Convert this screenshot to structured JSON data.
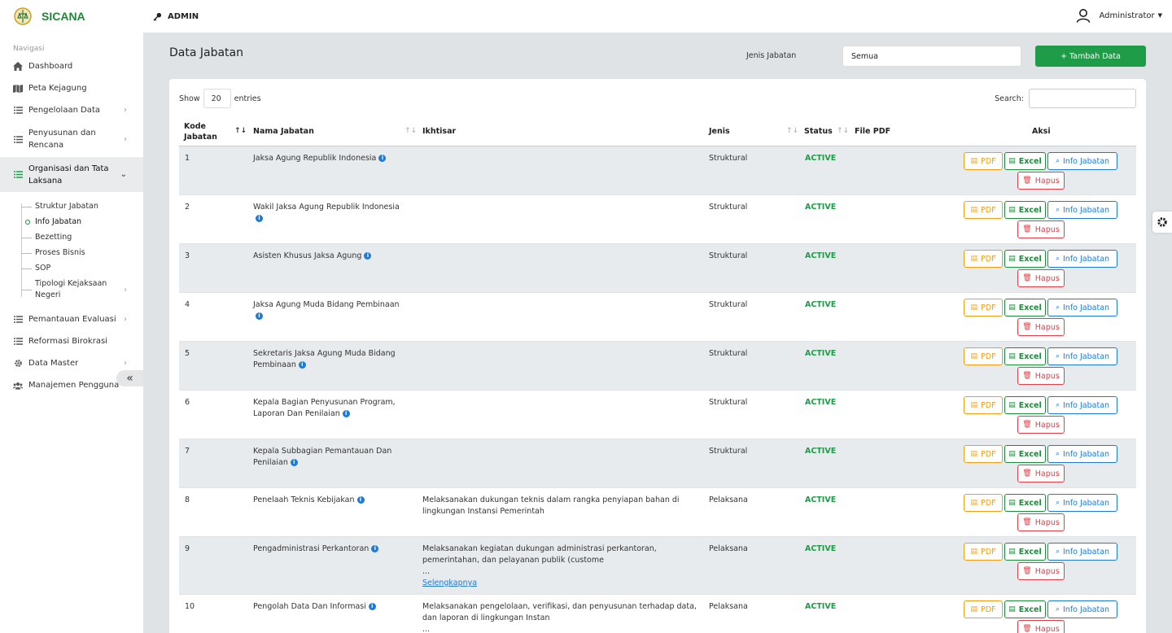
{
  "app": {
    "name": "SICANA",
    "role": "ADMIN",
    "user": "Administrator"
  },
  "sidebar": {
    "heading": "Navigasi",
    "items": [
      {
        "label": "Dashboard",
        "icon": "home-icon"
      },
      {
        "label": "Peta Kejagung",
        "icon": "map-icon"
      },
      {
        "label": "Pengelolaan Data",
        "icon": "list-icon"
      },
      {
        "label": "Penyusunan dan Rencana",
        "icon": "list-icon"
      },
      {
        "label": "Organisasi dan Tata Laksana",
        "icon": "list-icon"
      },
      {
        "label": "Pemantauan Evaluasi",
        "icon": "list-icon"
      },
      {
        "label": "Reformasi Birokrasi",
        "icon": "list-icon"
      },
      {
        "label": "Data Master",
        "icon": "gear-icon"
      },
      {
        "label": "Manajemen Pengguna",
        "icon": "users-icon"
      }
    ],
    "subitems": [
      "Struktur Jabatan",
      "Info Jabatan",
      "Bezetting",
      "Proses Bisnis",
      "SOP",
      "Tipologi Kejaksaan Negeri"
    ],
    "active_sub": "Info Jabatan",
    "collapse_glyph": "«"
  },
  "page": {
    "title": "Data Jabatan",
    "filter_label": "Jenis Jabatan",
    "filter_value": "Semua",
    "add_button": "+ Tambah Data"
  },
  "table": {
    "show_label": "Show",
    "entries_value": "20",
    "entries_label": "entries",
    "search_label": "Search:",
    "columns": [
      "Kode Jabatan",
      "Nama Jabatan",
      "Ikhtisar",
      "Jenis",
      "Status",
      "File PDF",
      "Aksi"
    ],
    "actions": {
      "pdf": "PDF",
      "excel": "Excel",
      "info": "Info Jabatan",
      "delete": "Hapus"
    },
    "rows": [
      {
        "kode": "1",
        "nama": "Jaksa Agung Republik Indonesia",
        "ikhtisar": "",
        "jenis": "Struktural",
        "status": "ACTIVE"
      },
      {
        "kode": "2",
        "nama": "Wakil Jaksa Agung Republik Indonesia",
        "ikhtisar": "",
        "jenis": "Struktural",
        "status": "ACTIVE"
      },
      {
        "kode": "3",
        "nama": "Asisten Khusus Jaksa Agung",
        "ikhtisar": "",
        "jenis": "Struktural",
        "status": "ACTIVE"
      },
      {
        "kode": "4",
        "nama": "Jaksa Agung Muda Bidang Pembinaan",
        "ikhtisar": "",
        "jenis": "Struktural",
        "status": "ACTIVE"
      },
      {
        "kode": "5",
        "nama": "Sekretaris Jaksa Agung Muda Bidang Pembinaan",
        "ikhtisar": "",
        "jenis": "Struktural",
        "status": "ACTIVE"
      },
      {
        "kode": "6",
        "nama": "Kepala Bagian Penyusunan Program, Laporan Dan Penilaian",
        "ikhtisar": "",
        "jenis": "Struktural",
        "status": "ACTIVE"
      },
      {
        "kode": "7",
        "nama": "Kepala Subbagian Pemantauan Dan Penilaian",
        "ikhtisar": "",
        "jenis": "Struktural",
        "status": "ACTIVE"
      },
      {
        "kode": "8",
        "nama": "Penelaah Teknis Kebijakan",
        "ikhtisar": "Melaksanakan dukungan teknis dalam rangka penyiapan bahan di lingkungan Instansi Pemerintah",
        "jenis": "Pelaksana",
        "status": "ACTIVE"
      },
      {
        "kode": "9",
        "nama": "Pengadministrasi Perkantoran",
        "ikhtisar": "Melaksanakan kegiatan dukungan administrasi perkantoran, pemerintahan, dan pelayanan publik (custome\n...",
        "more": "Selengkapnya",
        "jenis": "Pelaksana",
        "status": "ACTIVE"
      },
      {
        "kode": "10",
        "nama": "Pengolah Data Dan Informasi",
        "ikhtisar": "Melaksanakan pengelolaan, verifikasi, dan penyusunan terhadap data, dan laporan di lingkungan Instan\n...",
        "jenis": "Pelaksana",
        "status": "ACTIVE"
      }
    ]
  }
}
